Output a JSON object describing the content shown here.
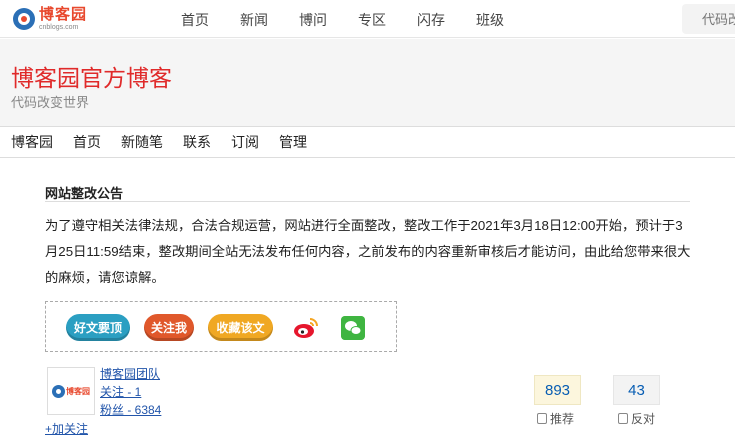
{
  "site": {
    "logo_cn": "博客园",
    "logo_en": "cnblogs.com",
    "nav": [
      "首页",
      "新闻",
      "博问",
      "专区",
      "闪存",
      "班级"
    ],
    "search_placeholder": "代码改变世界"
  },
  "blog": {
    "title": "博客园官方博客",
    "subtitle": "代码改变世界",
    "nav": [
      "博客园",
      "首页",
      "新随笔",
      "联系",
      "订阅",
      "管理"
    ]
  },
  "post": {
    "title": "网站整改公告",
    "body": "为了遵守相关法律法规，合法合规运营，网站进行全面整改，整改工作于2021年3月18日12:00开始，预计于3月25日11:59结束，整改期间全站无法发布任何内容，之前发布的内容重新审核后才能访问，由此给您带来很大的麻烦，请您谅解。"
  },
  "share": {
    "good_label": "好文要顶",
    "follow_label": "关注我",
    "fav_label": "收藏该文",
    "weibo_icon": "weibo-icon",
    "wechat_icon": "wechat-icon"
  },
  "author": {
    "avatar_text": "博客园",
    "name": "博客园团队",
    "following": "关注 - 1",
    "fans": "粉丝 - 6384",
    "follow_action": "+加关注"
  },
  "votes": {
    "digg_count": "893",
    "bury_count": "43",
    "digg_label": "推荐",
    "bury_label": "反对"
  },
  "colors": {
    "brand_red": "#e02a2a",
    "link_blue": "#2255aa",
    "btn_good": "#2b9fc2",
    "btn_follow": "#e0582b",
    "btn_fav": "#f0a823"
  }
}
